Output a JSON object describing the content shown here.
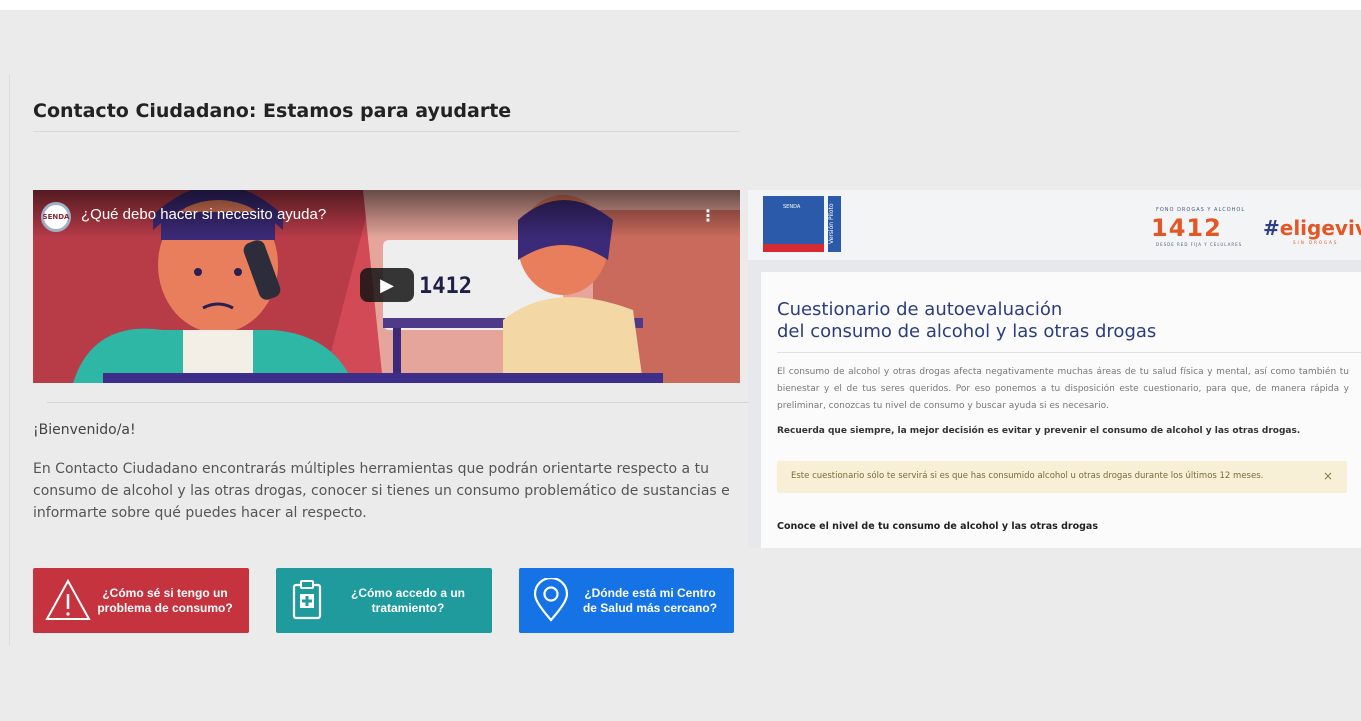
{
  "page": {
    "title": "Contacto Ciudadano: Estamos para ayudarte",
    "welcome": "¡Bienvenido/a!",
    "intro": "En Contacto Ciudadano encontrarás múltiples herramientas que podrán orientarte respecto a tu consumo de alcohol y las otras drogas, conocer si tienes un consumo problemático de sustancias e informarte sobre qué puedes hacer al respecto."
  },
  "video": {
    "title": "¿Qué debo hacer si necesito ayuda?",
    "channel": "SENDA",
    "screen_number": "1412",
    "menu_glyph": "⋮",
    "play_glyph": "▶"
  },
  "buttons": [
    {
      "label": "¿Cómo sé si tengo un problema de consumo?",
      "icon": "warning-icon",
      "color": "#c5333f"
    },
    {
      "label": "¿Cómo accedo a un tratamiento?",
      "icon": "medical-kit-icon",
      "color": "#1f9b9e"
    },
    {
      "label": "¿Dónde está mi Centro de Salud más cercano?",
      "icon": "location-pin-icon",
      "color": "#1673e6"
    }
  ],
  "questionnaire": {
    "logo_text": "SENDA",
    "logo_side": "Versión Piloto",
    "fono_label": "FONO DROGAS Y ALCOHOL",
    "fono_number": "1412",
    "fono_sub": "DESDE RED FIJA Y CELULARES",
    "hashtag_prefix": "#",
    "hashtag_word": "eligevivir",
    "hashtag_sub": "SIN DROGAS",
    "title_line1": "Cuestionario de autoevaluación",
    "title_line2": "del consumo de alcohol y las otras drogas",
    "description": "El consumo de alcohol y otras drogas afecta negativamente muchas áreas de tu salud física y mental, así como también tu bienestar y el de tus seres queridos. Por eso ponemos a tu disposición este cuestionario, para que, de manera rápida y preliminar, conozcas tu nivel de consumo y buscar ayuda si es necesario.",
    "note": "Recuerda que siempre, la mejor decisión es evitar y prevenir el consumo de alcohol y las otras drogas.",
    "alert": "Este cuestionario sólo te servirá si es que has consumido alcohol u otras drogas durante los últimos 12 meses.",
    "alert_close": "×",
    "section_heading": "Conoce el nivel de tu consumo de alcohol y las otras drogas"
  },
  "colors": {
    "background": "#ebebeb",
    "navy": "#2c3d7e",
    "orange": "#e35727",
    "alert_bg": "#f7efd6"
  }
}
